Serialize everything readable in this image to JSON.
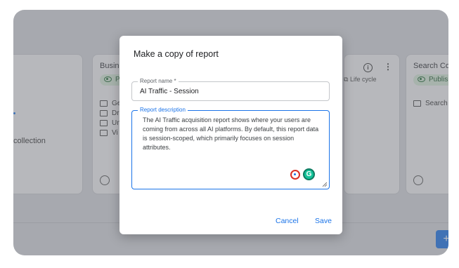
{
  "background": {
    "collection_label": "collection",
    "card_business": {
      "title": "Busine",
      "badge": "P",
      "items": [
        "Ge",
        "Dri",
        "Un",
        "Vi"
      ]
    },
    "card_lifecycle": {
      "label": "Life cycle",
      "info_icon": "i",
      "more_icon": "⋮"
    },
    "card_search": {
      "title": "Search Co",
      "badge": "Publis",
      "items": [
        "Search"
      ]
    },
    "fab_label": "+"
  },
  "dialog": {
    "title": "Make a copy of report",
    "name_field": {
      "label": "Report name *",
      "value": "AI Traffic - Session"
    },
    "description_field": {
      "label": "Report description",
      "value": "The AI Traffic acquisition report shows where your users are coming from across all AI platforms. By default, this report data is session-scoped, which primarily focuses on session attributes."
    },
    "grammarly_icon": "G",
    "cancel_label": "Cancel",
    "save_label": "Save"
  },
  "colors": {
    "accent": "#1a73e8",
    "badge_bg": "#d5e9d8",
    "badge_text": "#1f5c2e",
    "overlay": "#6e7078"
  }
}
